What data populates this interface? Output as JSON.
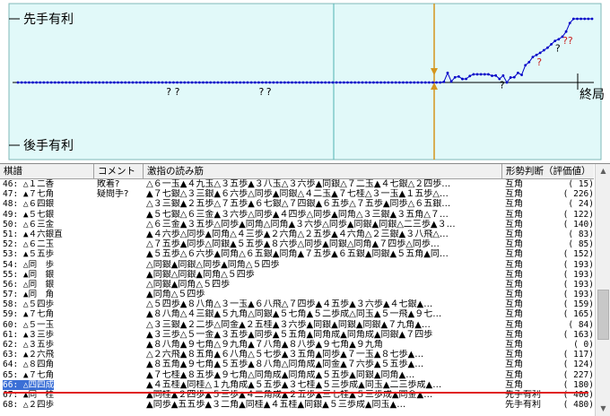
{
  "graph": {
    "label_top": "先手有利",
    "label_bottom": "後手有利",
    "label_end": "終局",
    "colors": {
      "bg": "#e1f9f9",
      "frame": "#7fb8b8",
      "line": "#0000c8",
      "mark": "#c81e1e",
      "cursor": "#d4961e",
      "teal": "#50b4b4"
    },
    "evaluations": [
      0,
      0,
      0,
      0,
      0,
      0,
      0,
      0,
      0,
      0,
      0,
      0,
      0,
      0,
      0,
      0,
      0,
      0,
      0,
      0,
      0,
      0,
      0,
      0,
      0,
      0,
      0,
      0,
      0,
      0,
      0,
      0,
      0,
      0,
      0,
      0,
      0,
      0,
      0,
      0,
      0,
      0,
      0,
      0,
      0,
      0,
      0,
      0,
      0,
      0,
      0,
      0,
      0,
      0,
      0,
      0,
      0,
      0,
      0,
      0,
      0,
      0,
      0,
      0,
      0,
      0,
      0,
      0,
      0,
      0,
      0,
      0,
      0,
      0,
      0,
      0,
      0,
      0,
      0,
      0,
      0,
      0,
      0,
      0,
      0,
      0,
      0,
      0,
      0,
      0,
      0,
      0,
      0,
      0,
      0,
      0,
      0,
      0,
      0,
      0,
      0,
      0,
      0,
      0,
      0,
      0,
      0,
      0,
      0,
      0,
      0,
      0,
      0,
      0,
      0,
      15,
      226,
      24,
      122,
      140,
      83,
      85,
      152,
      193,
      193,
      193,
      193,
      193,
      159,
      165,
      84,
      163,
      0,
      117,
      124,
      227,
      180,
      406,
      480,
      600,
      650,
      700,
      760,
      820,
      900,
      980,
      1020,
      1080,
      1200,
      1400,
      1500,
      1500,
      1500,
      1500,
      1500,
      1500
    ],
    "annotations": [
      {
        "move": 41,
        "text": "? ?",
        "color": "black"
      },
      {
        "move": 66,
        "text": "?",
        "color": "black"
      },
      {
        "move": 68,
        "text": "?",
        "color": "black"
      },
      {
        "move": 131,
        "text": "?",
        "color": "black"
      },
      {
        "move": 141,
        "text": "?",
        "color": "red"
      },
      {
        "move": 146,
        "text": "?",
        "color": "black"
      },
      {
        "move": 148,
        "text": "??",
        "color": "red"
      }
    ]
  },
  "table": {
    "headers": {
      "move": "棋譜",
      "comment": "コメント",
      "pv": "激指の読み筋",
      "eval": "形勢判断（評価値）"
    },
    "rows": [
      {
        "move": "46: △１二香",
        "comment": "敗着?",
        "pv": "△６一玉▲４九玉△３五歩▲３八玉△３六歩▲同銀△７二玉▲４七銀△２四歩…",
        "eval": "互角",
        "value": "(    15)"
      },
      {
        "move": "47: ▲７七角",
        "comment": "疑問手?",
        "pv": "▲７七銀△３三銀▲６六歩△同歩▲同銀△４二玉▲７七桂△３一玉▲１五歩△…",
        "eval": "互角",
        "value": "(   226)"
      },
      {
        "move": "48: △６四銀",
        "comment": "",
        "pv": "△３三銀▲２五歩△７五歩▲６七銀△７四銀▲６五歩△７五歩▲同歩△６五銀…",
        "eval": "互角",
        "value": "(    24)"
      },
      {
        "move": "49: ▲５七銀",
        "comment": "",
        "pv": "▲５七銀△６三金▲３六歩△同歩▲４四歩△同歩▲同角△３三銀▲３五角△７…",
        "eval": "互角",
        "value": "(   122)"
      },
      {
        "move": "50: △６三金",
        "comment": "",
        "pv": "△６三金▲３五歩△同歩▲同角△同角▲３六歩△同歩▲同銀▲同銀△二三歩▲３…",
        "eval": "互角",
        "value": "(   140)"
      },
      {
        "move": "51: ▲４六銀直",
        "comment": "",
        "pv": "▲４六歩△同歩▲同角△４三歩▲２六角△２五歩▲４六角△２三銀▲３八飛△…",
        "eval": "互角",
        "value": "(    83)"
      },
      {
        "move": "52: △６二玉",
        "comment": "",
        "pv": "△７五歩▲同歩△同銀▲５五歩▲８六歩△同歩▲同銀△同角▲７四歩△同歩…",
        "eval": "互角",
        "value": "(    85)"
      },
      {
        "move": "53: ▲５五歩",
        "comment": "",
        "pv": "▲５五歩△６六歩▲同角△６五銀▲同角▲７五歩▲６五銀▲同銀▲５五角▲同…",
        "eval": "互角",
        "value": "(   152)"
      },
      {
        "move": "54: △同　歩",
        "comment": "",
        "pv": "△同銀▲同銀△同歩▲同角△５四歩",
        "eval": "互角",
        "value": "(   193)"
      },
      {
        "move": "55: ▲同　銀",
        "comment": "",
        "pv": "▲同銀△同銀▲同角△５四歩",
        "eval": "互角",
        "value": "(   193)"
      },
      {
        "move": "56: △同　銀",
        "comment": "",
        "pv": "△同銀▲同角△５四歩",
        "eval": "互角",
        "value": "(   193)"
      },
      {
        "move": "57: ▲同　角",
        "comment": "",
        "pv": "▲同角△５四歩",
        "eval": "互角",
        "value": "(   193)"
      },
      {
        "move": "58: △５四歩",
        "comment": "",
        "pv": "△５四歩▲８八角△３一玉▲６八飛△７四歩▲４五歩▲３六歩▲４七銀▲…",
        "eval": "互角",
        "value": "(   159)"
      },
      {
        "move": "59: ▲７七角",
        "comment": "",
        "pv": "▲８八角△４三銀▲５九角△同銀▲５七角▲５二歩成△同玉▲５一飛▲９七…",
        "eval": "互角",
        "value": "(   165)"
      },
      {
        "move": "60: △５一玉",
        "comment": "",
        "pv": "△３三銀▲２二歩△同金▲２五桂▲３六歩▲同銀▲同銀▲同銀▲７九角▲…",
        "eval": "互角",
        "value": "(    84)"
      },
      {
        "move": "61: ▲３三歩",
        "comment": "",
        "pv": "▲３三歩△５一金▲３五歩▲同歩▲５五角▲同角成▲同角成▲同銀▲７四歩",
        "eval": "互角",
        "value": "(   163)"
      },
      {
        "move": "62: △３五歩",
        "comment": "",
        "pv": "▲８八角▲９七角△９九角▲７八角▲８八歩▲９七角▲９九角",
        "eval": "互角",
        "value": "(     0)"
      },
      {
        "move": "63: ▲２六飛",
        "comment": "",
        "pv": "△２六飛▲８五角▲６八角△５七歩▲３五角▲同歩▲７一玉▲８七歩▲…",
        "eval": "互角",
        "value": "(   117)"
      },
      {
        "move": "64: △８四角",
        "comment": "",
        "pv": "▲８五角▲９七角▲５五歩▲８八角△同角成▲同金▲７六歩▲５五歩▲…",
        "eval": "互角",
        "value": "(   124)"
      },
      {
        "move": "65: ▲７七角",
        "comment": "",
        "pv": "▲７七桂▲８五歩▲９七角△同角成▲同角成▲５五歩▲同銀▲同角▲…",
        "eval": "互角",
        "value": "(   227)"
      },
      {
        "move": "66: △四四成",
        "comment": "",
        "pv": "▲４五桂▲同桂△１九角成▲５五歩▲３七桂▲５三歩成▲同玉▲二三歩成▲…",
        "eval": "互角",
        "value": "(   180)"
      },
      {
        "move": "67: ▲同　桂",
        "comment": "",
        "pv": "▲同桂▲２四歩▲５三歩▲４二角成▲２五歩▲三七桂▲５三歩成▲同金▲…",
        "eval": "先手有利",
        "value": "(   406)"
      },
      {
        "move": "68: △２四歩",
        "comment": "",
        "pv": "▲同歩▲五五歩▲３二角▲同桂▲４五桂▲同銀▲５三歩成▲同玉▲…",
        "eval": "先手有利",
        "value": "(   480)"
      }
    ],
    "selected_row": 20
  }
}
